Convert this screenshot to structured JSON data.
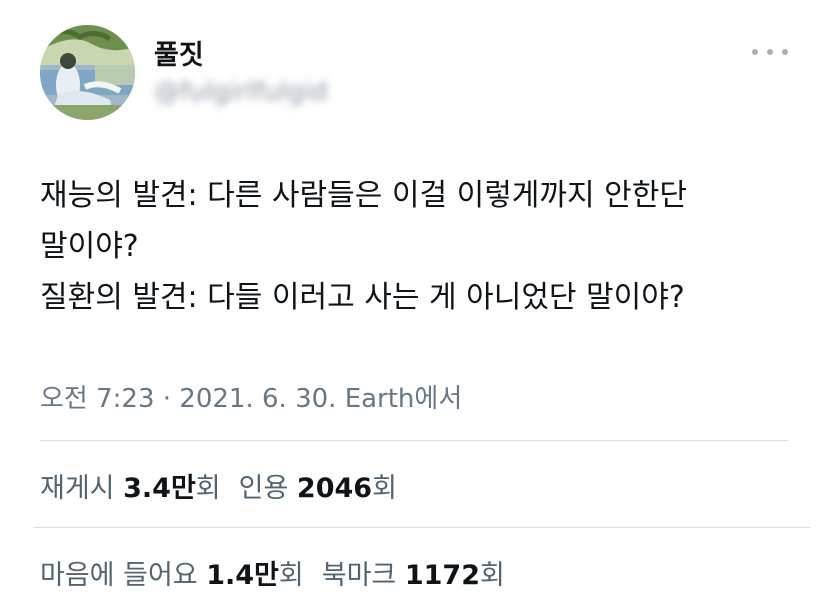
{
  "author": {
    "display_name": "풀짓",
    "handle": "@fulgirlfulgid"
  },
  "tweet": {
    "lines": [
      "재능의 발견: 다른 사람들은 이걸 이렇게까지 안한단",
      "말이야?",
      "질환의 발견: 다들 이러고 사는 게 아니었단 말이야?"
    ]
  },
  "meta": {
    "time": "오전 7:23",
    "separator": "·",
    "date": "2021. 6. 30.",
    "source": "Earth에서"
  },
  "stats": {
    "retweets_label": "재게시",
    "retweets_value": "3.4만",
    "retweets_unit": "회",
    "quotes_label": "인용",
    "quotes_value": "2046",
    "quotes_unit": "회",
    "likes_label": "마음에 들어요",
    "likes_value": "1.4만",
    "likes_unit": "회",
    "bookmarks_label": "북마크",
    "bookmarks_value": "1172",
    "bookmarks_unit": "회"
  },
  "icons": {
    "more": "more-horizontal-icon"
  },
  "colors": {
    "text_primary": "#0f1419",
    "text_secondary": "#536471",
    "divider": "#d8dee3"
  }
}
